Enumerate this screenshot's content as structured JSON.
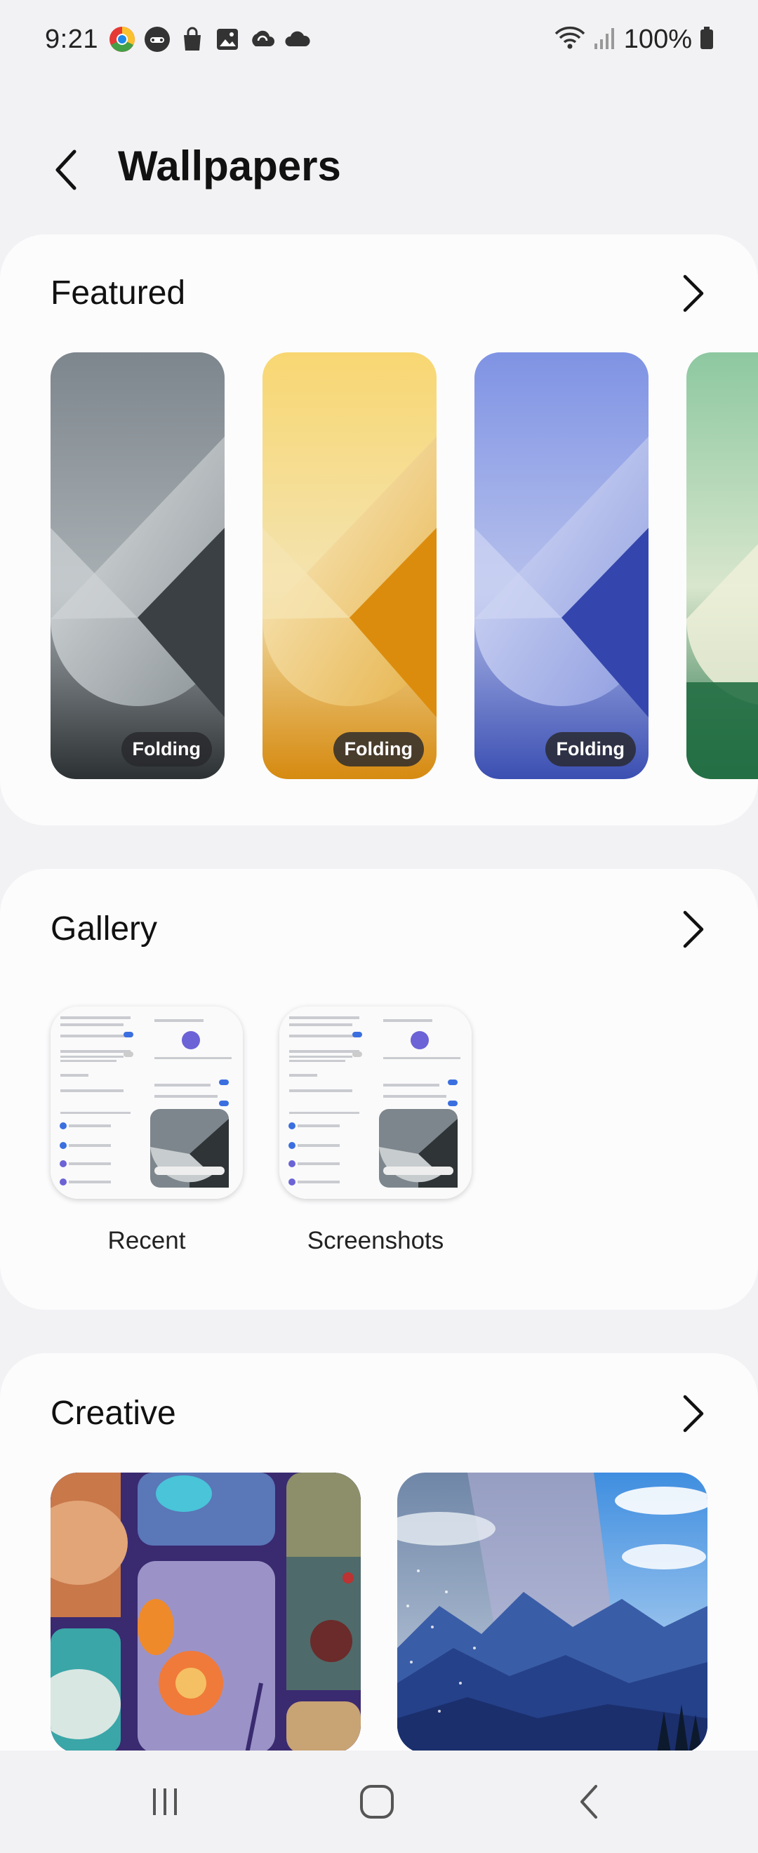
{
  "status_bar": {
    "time": "9:21",
    "battery": "100%",
    "notification_icons": [
      "chrome-icon",
      "game-icon",
      "bag-icon",
      "gallery-icon",
      "sync-icon",
      "cloud-icon"
    ]
  },
  "header": {
    "title": "Wallpapers"
  },
  "featured": {
    "title": "Featured",
    "items": [
      {
        "badge": "Folding",
        "color": "#8a9199"
      },
      {
        "badge": "Folding",
        "color": "#e39a14"
      },
      {
        "badge": "Folding",
        "color": "#4a5fc4"
      },
      {
        "badge": "",
        "color": "#2f8a57"
      }
    ]
  },
  "gallery": {
    "title": "Gallery",
    "items": [
      {
        "label": "Recent"
      },
      {
        "label": "Screenshots"
      }
    ]
  },
  "creative": {
    "title": "Creative"
  },
  "nav": {
    "icons": [
      "recents-icon",
      "home-icon",
      "back-icon"
    ]
  },
  "colors": {
    "background": "#f2f2f4",
    "card": "#fcfcfd",
    "accent": "#3b6fe0"
  }
}
